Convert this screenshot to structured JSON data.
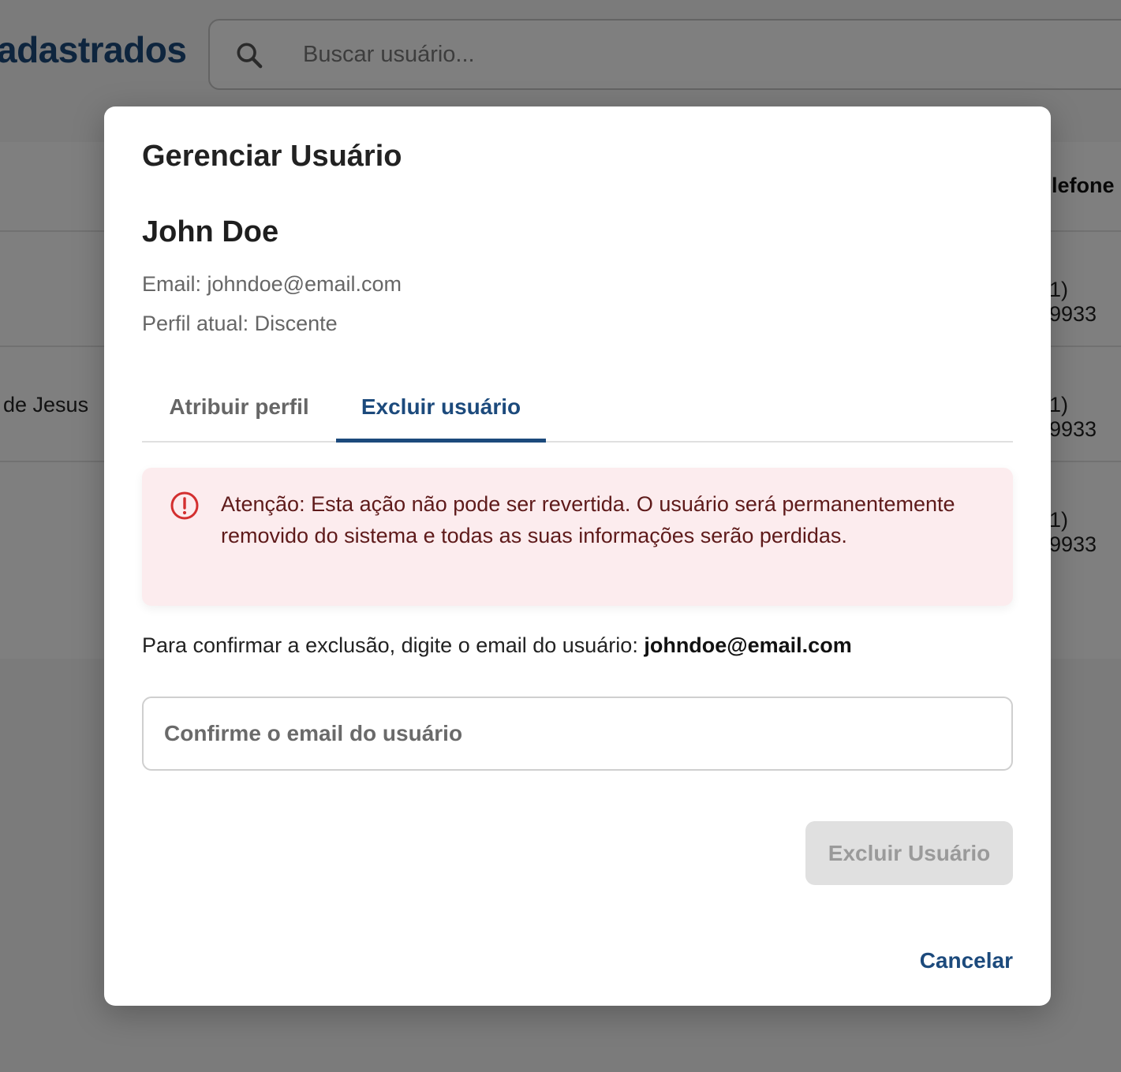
{
  "background": {
    "page_title": "adastrados",
    "search": {
      "placeholder": "Buscar usuário..."
    },
    "table": {
      "header_phone": "elefone",
      "rows": [
        {
          "name": "",
          "phone": "1) 9933"
        },
        {
          "name": "de Jesus",
          "phone": "1) 9933"
        },
        {
          "name": "",
          "phone": "1) 9933"
        }
      ]
    }
  },
  "modal": {
    "title": "Gerenciar Usuário",
    "user": {
      "name": "John Doe",
      "email_line": "Email: johndoe@email.com",
      "profile_line": "Perfil atual: Discente"
    },
    "tabs": [
      {
        "label": "Atribuir perfil",
        "active": false
      },
      {
        "label": "Excluir usuário",
        "active": true
      }
    ],
    "alert": {
      "icon": "alert-circle-icon",
      "text": "Atenção: Esta ação não pode ser revertida. O usuário será permanentemente removido do sistema e todas as suas informações serão perdidas."
    },
    "confirm": {
      "label": "Para confirmar a exclusão, digite o email do usuário:",
      "email": "johndoe@email.com",
      "input_placeholder": "Confirme o email do usuário",
      "input_value": ""
    },
    "delete_button": {
      "label": "Excluir Usuário",
      "disabled": true
    },
    "cancel_button": {
      "label": "Cancelar"
    }
  },
  "colors": {
    "primary": "#1c4a7c",
    "alert_bg": "#fcecee",
    "alert_icon": "#d32f2f",
    "alert_text": "#5e1a1a",
    "disabled_bg": "#e0e0e0",
    "disabled_text": "#9a9a9a"
  }
}
